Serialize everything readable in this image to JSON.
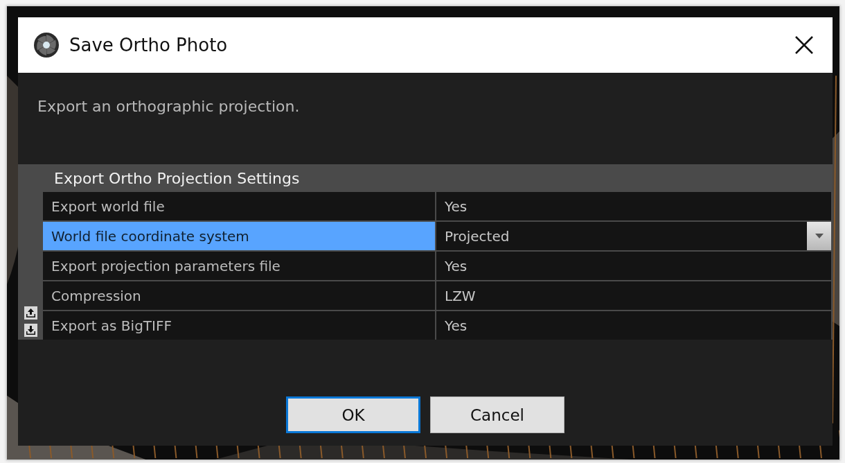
{
  "window": {
    "title": "Save Ortho Photo"
  },
  "description": "Export an orthographic projection.",
  "property_grid": {
    "category": "Export Ortho Projection Settings",
    "rows": [
      {
        "name": "Export world file",
        "value": "Yes",
        "selected": false,
        "kind": "text"
      },
      {
        "name": "World file coordinate system",
        "value": "Projected",
        "selected": true,
        "kind": "dropdown"
      },
      {
        "name": "Export projection parameters file",
        "value": "Yes",
        "selected": false,
        "kind": "text"
      },
      {
        "name": "Compression",
        "value": "LZW",
        "selected": false,
        "kind": "text"
      },
      {
        "name": "Export as BigTIFF",
        "value": "Yes",
        "selected": false,
        "kind": "text"
      }
    ]
  },
  "buttons": [
    {
      "label": "OK",
      "focused": true
    },
    {
      "label": "Cancel",
      "focused": false
    }
  ]
}
